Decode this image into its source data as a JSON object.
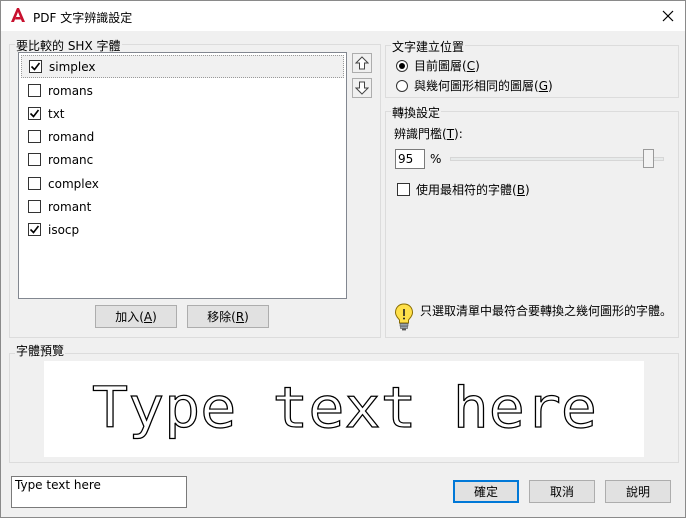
{
  "window": {
    "title": "PDF 文字辨識設定",
    "close_label": "×"
  },
  "fonts_panel": {
    "title": "要比較的 SHX 字體",
    "items": [
      {
        "label": "simplex",
        "checked": true
      },
      {
        "label": "romans",
        "checked": false
      },
      {
        "label": "txt",
        "checked": true
      },
      {
        "label": "romand",
        "checked": false
      },
      {
        "label": "romanc",
        "checked": false
      },
      {
        "label": "complex",
        "checked": false
      },
      {
        "label": "romant",
        "checked": false
      },
      {
        "label": "isocp",
        "checked": true
      }
    ],
    "add_label": "加入",
    "add_key": "A",
    "remove_label": "移除",
    "remove_key": "R"
  },
  "text_layer": {
    "title": "文字建立位置",
    "options": [
      {
        "label": "目前圖層",
        "key": "C",
        "selected": true
      },
      {
        "label": "與幾何圖形相同的圖層",
        "key": "G",
        "selected": false
      }
    ]
  },
  "conversion": {
    "title": "轉換設定",
    "threshold_label": "辨識門檻",
    "threshold_key": "T",
    "threshold_value": "95",
    "threshold_unit": "%",
    "threshold_level": 95,
    "best_match_label": "使用最相符的字體",
    "best_match_key": "B",
    "best_match_checked": false,
    "hint": "只選取清單中最符合要轉換之幾何圖形的字體。"
  },
  "preview": {
    "title": "字體預覽",
    "sample_text": "Type text here"
  },
  "sample_input": {
    "value": "Type text here"
  },
  "footer": {
    "ok_label": "確定",
    "cancel_label": "取消",
    "help_label": "說明"
  }
}
